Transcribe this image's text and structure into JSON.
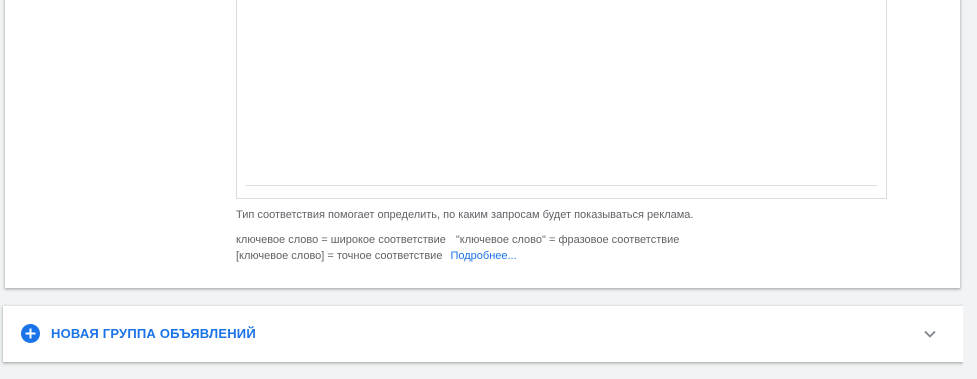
{
  "keywords_section": {
    "match_type_help": "Тип соответствия помогает определить, по каким запросам будет показываться реклама.",
    "broad_example": "ключевое слово = широкое соответствие",
    "phrase_example": "\"ключевое слово\" = фразовое соответствие",
    "exact_example": "[ключевое слово] = точное соответствие",
    "more_link": "Подробнее..."
  },
  "new_ad_group": {
    "label": "НОВАЯ ГРУППА ОБЪЯВЛЕНИЙ",
    "icon": "add-circle-icon",
    "expand_icon": "chevron-down-icon"
  },
  "colors": {
    "accent": "#1a73e8",
    "text_secondary": "#5f6368",
    "background": "#f1f3f4",
    "border": "#dadce0"
  }
}
